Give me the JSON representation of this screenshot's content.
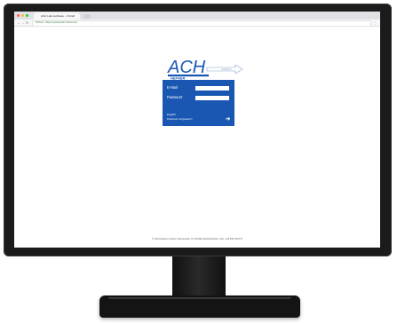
{
  "browser": {
    "tab_title": "ACH Laborsoftware – Portal",
    "tab_close": "×",
    "url": "Sicher | https://portal.ach-hefner.de",
    "menu": "⋮",
    "nav_back": "←",
    "nav_forward": "→",
    "nav_reload": "↻"
  },
  "logo": {
    "wordmark": "ACH",
    "subtext": "HEFNER",
    "tag": "Software"
  },
  "login": {
    "email_label": "E-Mail",
    "password_label": "Passwort",
    "language_link": "English",
    "forgot_link": "Passwort vergessen?",
    "submit_icon": "➜"
  },
  "footer": {
    "text": "© ACH Hefner GmbH | Siemensstr. 8 | 97209 Veitshöchheim | Tel: +49 931 9707-0"
  },
  "colors": {
    "login_bg": "#1a57b3",
    "logo_blue": "#1a57b3",
    "bezel": "#1b1b1c"
  }
}
